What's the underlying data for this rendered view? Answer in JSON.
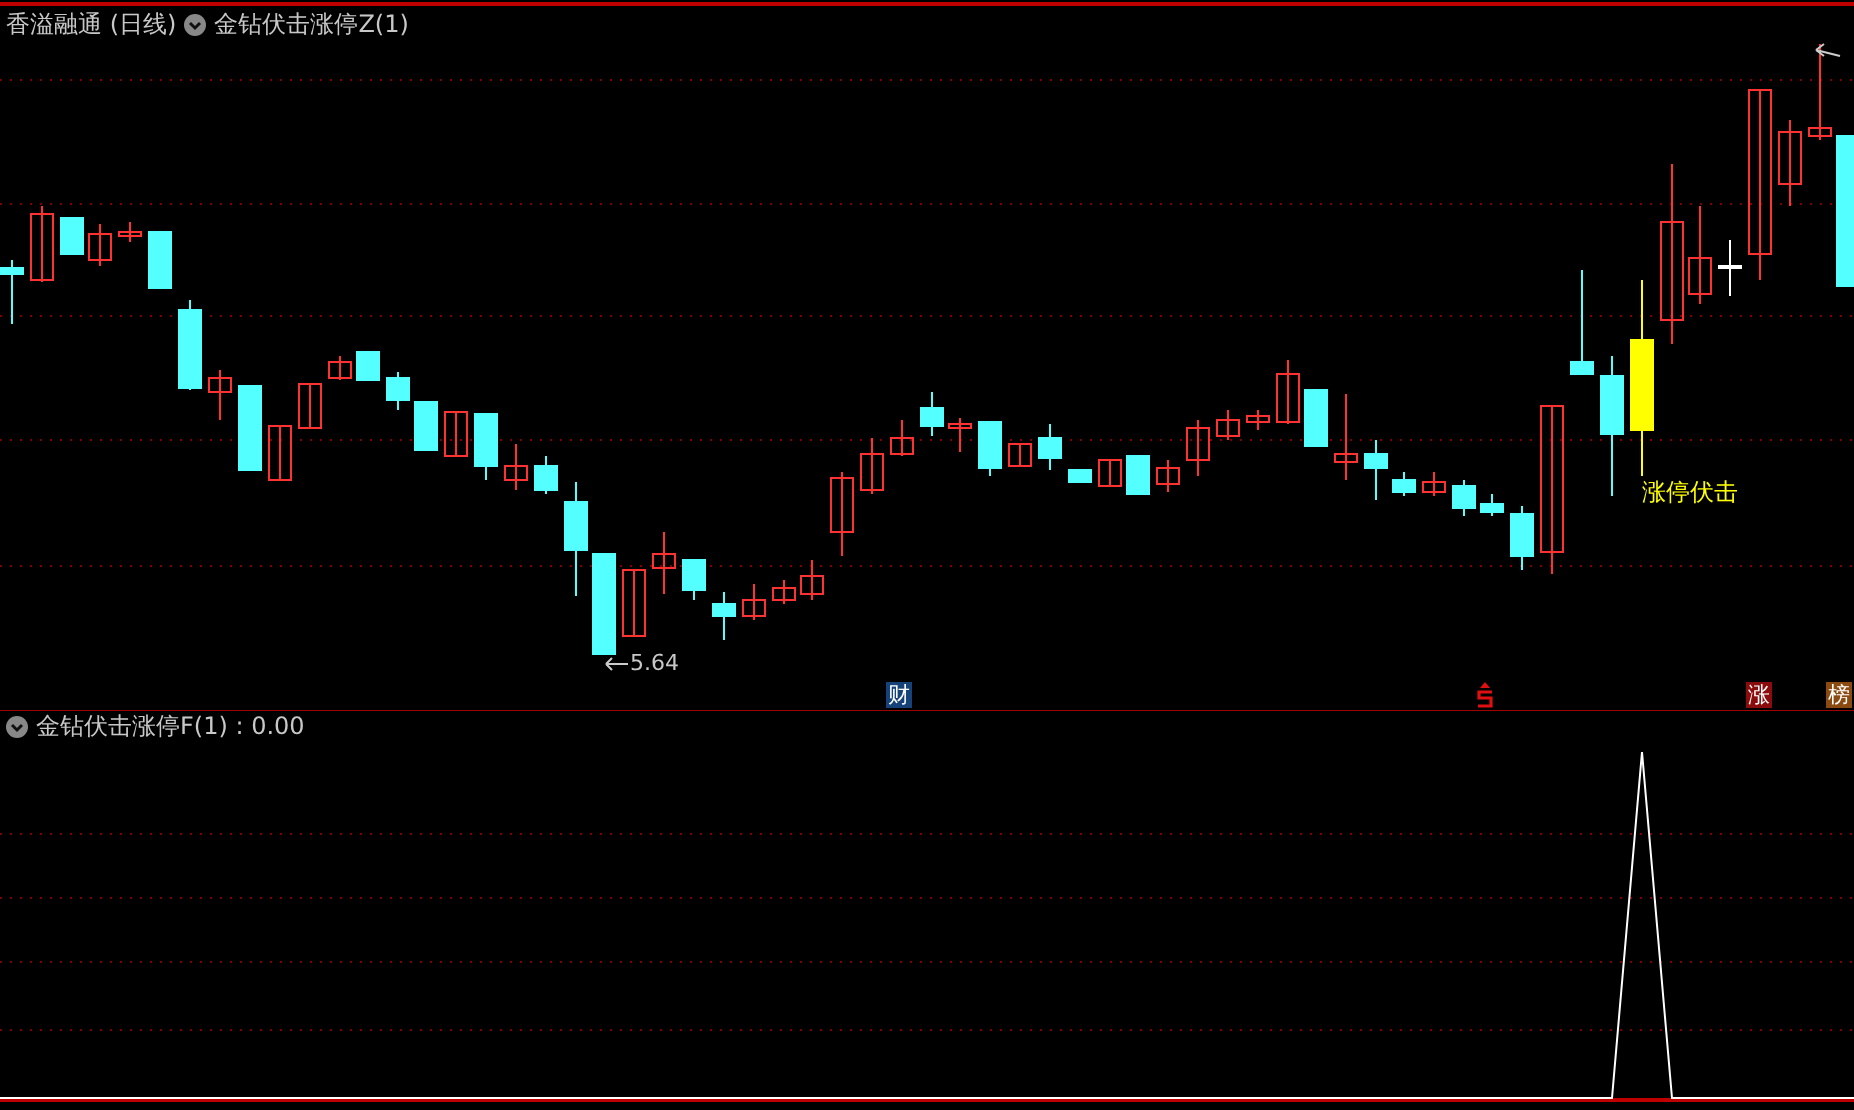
{
  "main_panel": {
    "title": "香溢融通 (日线)",
    "indicator": "金钻伏击涨停Z(1)",
    "low_label": "5.64",
    "signal_label": "涨停伏击",
    "markers": [
      {
        "kind": "text",
        "label": "财",
        "color": "#16427a"
      },
      {
        "kind": "icon",
        "color": "#e01010"
      },
      {
        "kind": "text",
        "label": "涨",
        "color": "#8a0c0c"
      },
      {
        "kind": "text",
        "label": "榜",
        "color": "#8a4a10"
      }
    ]
  },
  "sub_panel": {
    "title": "金钻伏击涨停F(1) : 0.00"
  }
}
